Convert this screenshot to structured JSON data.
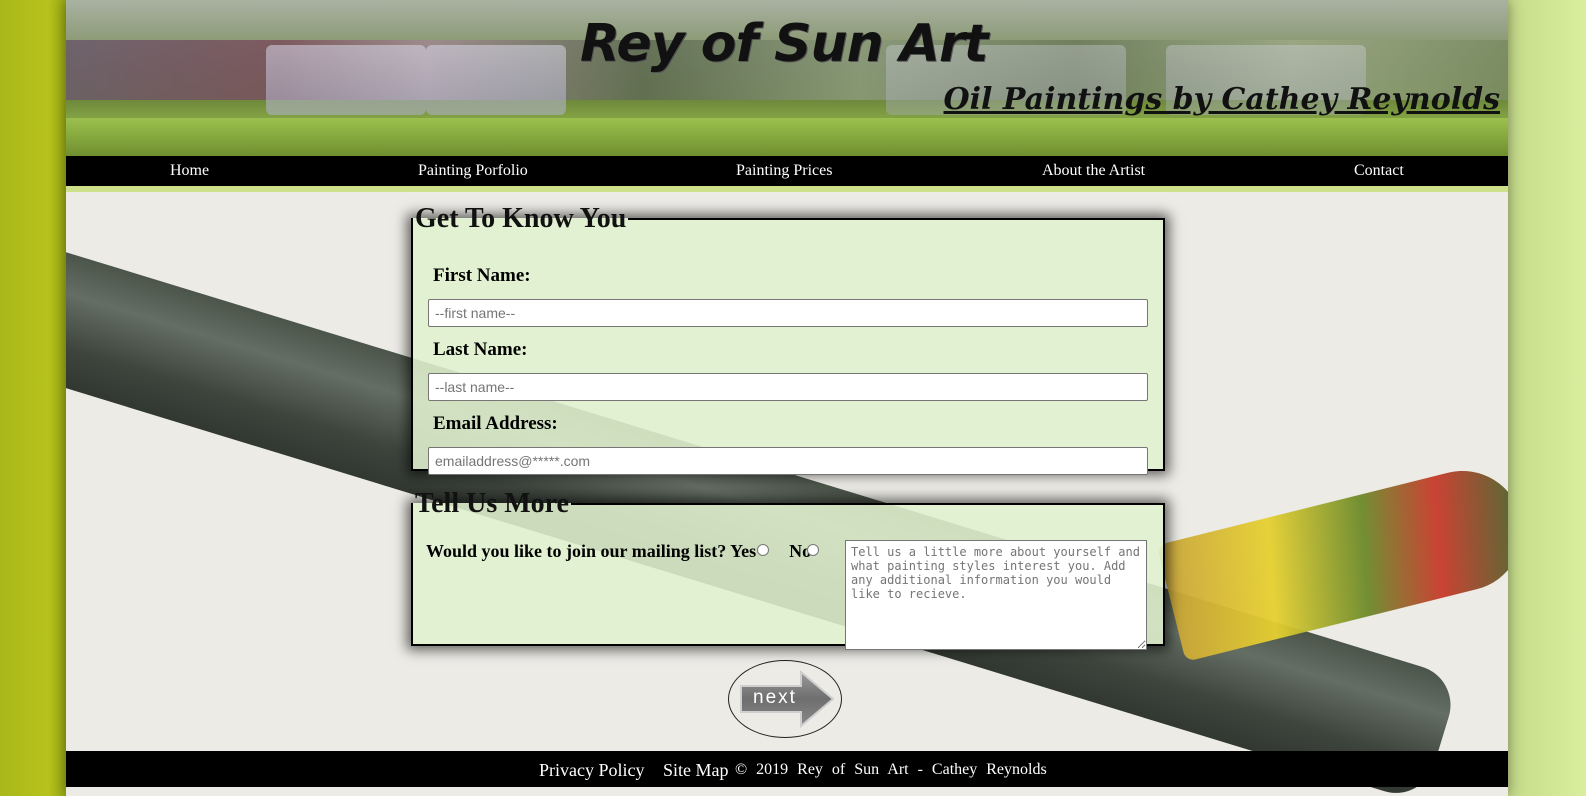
{
  "header": {
    "title": "Rey of Sun Art",
    "subtitle": "Oil Paintings by Cathey Reynolds"
  },
  "nav": {
    "items": [
      {
        "label": "Home"
      },
      {
        "label": "Painting Porfolio"
      },
      {
        "label": "Painting Prices"
      },
      {
        "label": "About the Artist"
      },
      {
        "label": "Contact"
      }
    ]
  },
  "form": {
    "section1": {
      "legend": "Get To Know You",
      "first_name_label": "First Name:",
      "first_name_placeholder": "--first name--",
      "last_name_label": "Last Name:",
      "last_name_placeholder": "--last name--",
      "email_label": "Email Address:",
      "email_placeholder": "emailaddress@*****.com"
    },
    "section2": {
      "legend": "Tell Us More",
      "mailing_question": "Would you like to join our mailing list?",
      "yes_label": "Yes",
      "no_label": "No",
      "comments_placeholder": "Tell us a little more about yourself and what painting styles interest you. Add any additional information you would like to recieve."
    },
    "next_label": "next"
  },
  "footer": {
    "privacy": "Privacy Policy",
    "sitemap": "Site Map",
    "copyright": "© 2019 Rey of Sun Art - Cathey Reynolds"
  }
}
